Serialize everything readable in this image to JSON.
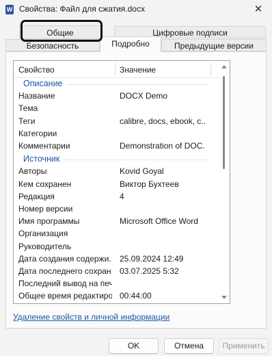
{
  "window": {
    "title": "Свойства: Файл для сжатия.docx",
    "app_icon_letter": "W",
    "close_glyph": "✕"
  },
  "tabs": {
    "general": "Общие",
    "digital_signatures": "Цифровые подписи",
    "security": "Безопасность",
    "details": "Подробно",
    "previous_versions": "Предыдущие версии",
    "active": "Подробно"
  },
  "list": {
    "header_property": "Свойство",
    "header_value": "Значение",
    "groups": [
      {
        "label": "Описание",
        "rows": [
          {
            "name": "Название",
            "value": "DOCX Demo"
          },
          {
            "name": "Тема",
            "value": ""
          },
          {
            "name": "Теги",
            "value": "calibre, docs, ebook, c..."
          },
          {
            "name": "Категории",
            "value": ""
          },
          {
            "name": "Комментарии",
            "value": "Demonstration of DOC..."
          }
        ]
      },
      {
        "label": "Источник",
        "rows": [
          {
            "name": "Авторы",
            "value": "Kovid Goyal"
          },
          {
            "name": "Кем сохранен",
            "value": "Виктор Бухтеев"
          },
          {
            "name": "Редакция",
            "value": "4"
          },
          {
            "name": "Номер версии",
            "value": ""
          },
          {
            "name": "Имя программы",
            "value": "Microsoft Office Word"
          },
          {
            "name": "Организация",
            "value": ""
          },
          {
            "name": "Руководитель",
            "value": ""
          },
          {
            "name": "Дата создания содержи...",
            "value": "25.09.2024 12:49"
          },
          {
            "name": "Дата последнего сохран...",
            "value": "03.07.2025 5:32"
          },
          {
            "name": "Последний вывод на печ...",
            "value": ""
          },
          {
            "name": "Общее время редактиро...",
            "value": "00:44:00"
          }
        ]
      }
    ]
  },
  "remove_properties_link": "Удаление свойств и личной информации",
  "buttons": {
    "ok": "OK",
    "cancel": "Отмена",
    "apply": "Применить"
  },
  "colors": {
    "group_label": "#1f56a8",
    "link": "#1f56a8",
    "word_icon": "#2b579a",
    "highlight_outline": "#111111"
  }
}
